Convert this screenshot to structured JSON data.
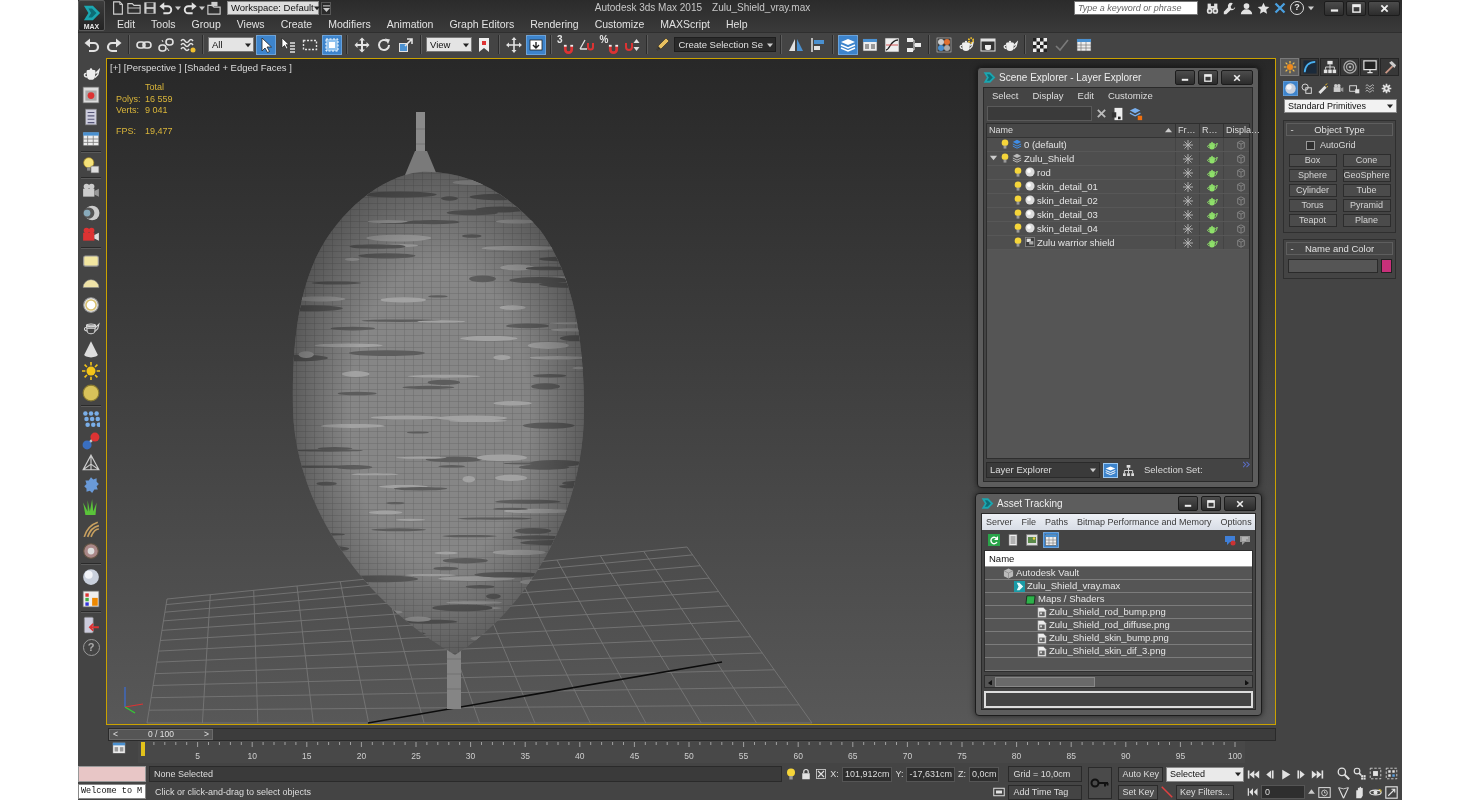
{
  "title_bar": {
    "logo": "MAX",
    "workspace": "Workspace: Default",
    "title": "Autodesk 3ds Max 2015",
    "file": "Zulu_Shield_vray.max",
    "search": {
      "placeholder": "Type a keyword or phrase"
    },
    "help": "?"
  },
  "menu": [
    "Edit",
    "Tools",
    "Group",
    "Views",
    "Create",
    "Modifiers",
    "Animation",
    "Graph Editors",
    "Rendering",
    "Customize",
    "MAXScript",
    "Help"
  ],
  "main_toolbar": [
    {
      "kind": "tool",
      "active": false
    },
    {
      "kind": "tool",
      "active": false
    },
    {
      "kind": "tool",
      "active": false
    },
    {
      "kind": "tool",
      "active": false
    },
    {
      "kind": "tool",
      "active": false
    },
    {
      "kind": "dropdown",
      "value": "All"
    },
    {
      "kind": "tool",
      "active": true
    },
    {
      "kind": "tool",
      "active": false
    },
    {
      "kind": "tool",
      "active": false
    },
    {
      "kind": "tool",
      "active": true
    },
    {
      "kind": "tool",
      "active": false
    },
    {
      "kind": "tool",
      "active": false
    },
    {
      "kind": "tool",
      "active": false
    },
    {
      "kind": "dropdown",
      "value": "View"
    },
    {
      "kind": "tool",
      "active": false
    },
    {
      "kind": "tool",
      "active": false
    },
    {
      "kind": "tool",
      "active": true
    },
    {
      "kind": "snap",
      "label": "3",
      "active": false
    },
    {
      "kind": "tool",
      "active": false
    },
    {
      "kind": "snap",
      "label": "%",
      "active": false
    },
    {
      "kind": "tool",
      "active": false
    },
    {
      "kind": "tool",
      "active": false
    },
    {
      "kind": "combo",
      "value": "Create Selection Se"
    },
    {
      "kind": "tool",
      "active": false
    },
    {
      "kind": "tool",
      "active": false
    },
    {
      "kind": "tool",
      "active": true
    },
    {
      "kind": "tool",
      "active": false
    },
    {
      "kind": "tool",
      "active": false
    },
    {
      "kind": "tool",
      "active": false
    },
    {
      "kind": "tool",
      "active": false
    },
    {
      "kind": "tool",
      "active": false
    },
    {
      "kind": "tool",
      "active": false
    },
    {
      "kind": "tool",
      "active": false
    },
    {
      "kind": "tool",
      "active": false
    },
    {
      "kind": "tool",
      "active": false
    },
    {
      "kind": "tool",
      "active": false
    }
  ],
  "left_toolbar": {
    "help": "?"
  },
  "viewport": {
    "labels": [
      "[+]",
      "[Perspective ]",
      "[Shaded + Edged Faces ]"
    ],
    "stats_heading": "Total",
    "counts": [
      {
        "label": "Polys:",
        "value": "16 559"
      },
      {
        "label": "Verts:",
        "value": "9 041"
      }
    ],
    "performance": [
      {
        "label": "FPS:",
        "value": "19,477"
      }
    ]
  },
  "scene_explorer": {
    "title": "Scene Explorer - Layer Explorer",
    "menu": [
      "Select",
      "Display",
      "Edit",
      "Customize"
    ],
    "columns": [
      "Name",
      "Fr…",
      "R…",
      "Displa…"
    ],
    "tree": [
      {
        "kind": "layer",
        "name": "0 (default)",
        "current": true,
        "visible": true,
        "frozen": false,
        "renderable": true
      },
      {
        "kind": "layer",
        "name": "Zulu_Shield",
        "current": false,
        "expanded": true,
        "visible": true,
        "frozen": false,
        "renderable": true,
        "children": [
          {
            "kind": "object",
            "name": "rod",
            "visible": true,
            "frozen": false,
            "renderable": true
          },
          {
            "kind": "object",
            "name": "skin_detail_01",
            "visible": true,
            "frozen": false,
            "renderable": true
          },
          {
            "kind": "object",
            "name": "skin_detail_02",
            "visible": true,
            "frozen": false,
            "renderable": true
          },
          {
            "kind": "object",
            "name": "skin_detail_03",
            "visible": true,
            "frozen": false,
            "renderable": true
          },
          {
            "kind": "object",
            "name": "skin_detail_04",
            "visible": true,
            "frozen": false,
            "renderable": true
          },
          {
            "kind": "group",
            "name": "Zulu warrior shield",
            "visible": true,
            "frozen": false,
            "renderable": true
          }
        ]
      }
    ],
    "explorer": "Layer Explorer",
    "modes": [
      {
        "selected": true
      },
      {
        "selected": false
      }
    ],
    "selection_set": "Selection Set:"
  },
  "asset_tracking": {
    "title": "Asset Tracking",
    "menu": [
      "Server",
      "File",
      "Paths",
      "Bitmap Performance and Memory",
      "Options"
    ],
    "views": [
      {
        "selected": false
      },
      {
        "selected": false
      },
      {
        "selected": false
      },
      {
        "selected": true
      }
    ],
    "columns": [
      "Name"
    ],
    "tree": [
      {
        "kind": "provider",
        "name": "Autodesk Vault",
        "children": [
          {
            "kind": "scene",
            "name": "Zulu_Shield_vray.max",
            "children": [
              {
                "kind": "folder",
                "name": "Maps / Shaders",
                "children": [
                  {
                    "kind": "bitmap",
                    "name": "Zulu_Shield_rod_bump.png"
                  },
                  {
                    "kind": "bitmap",
                    "name": "Zulu_Shield_rod_diffuse.png"
                  },
                  {
                    "kind": "bitmap",
                    "name": "Zulu_Shield_skin_bump.png"
                  },
                  {
                    "kind": "bitmap",
                    "name": "Zulu_Shield_skin_dif_3.png"
                  }
                ]
              }
            ]
          }
        ]
      }
    ]
  },
  "command_panel": {
    "tabs": [
      {
        "selected": true
      },
      {
        "selected": false
      },
      {
        "selected": false
      },
      {
        "selected": false
      },
      {
        "selected": false
      },
      {
        "selected": false
      }
    ],
    "categories": [
      {
        "selected": true
      },
      {
        "selected": false
      },
      {
        "selected": false
      },
      {
        "selected": false
      },
      {
        "selected": false
      },
      {
        "selected": false
      },
      {
        "selected": false
      }
    ],
    "object_class": "Standard Primitives",
    "rollouts": [
      {
        "kind": "object_type",
        "toggle": "-",
        "title": "Object Type",
        "autogrid": {
          "label": "AutoGrid",
          "checked": false
        },
        "buttons": [
          "Box",
          "Cone",
          "Sphere",
          "GeoSphere",
          "Cylinder",
          "Tube",
          "Torus",
          "Pyramid",
          "Teapot",
          "Plane"
        ]
      },
      {
        "kind": "name_and_color",
        "toggle": "-",
        "title": "Name and Color",
        "color": "#c8307a"
      }
    ]
  },
  "time_slider": {
    "prev": "<",
    "position": "0 / 100",
    "next": ">",
    "level": 0
  },
  "track_bar": {
    "labels": [
      "5",
      "10",
      "15",
      "20",
      "25",
      "30",
      "35",
      "40",
      "45",
      "50",
      "55",
      "60",
      "65",
      "70",
      "75",
      "80",
      "85",
      "90",
      "95",
      "100"
    ]
  },
  "status_bar": {
    "listener_output": "Welcome to M",
    "selection": "None Selected",
    "prompt": "Click or click-and-drag to select objects",
    "coordinates": [
      {
        "axis": "X:",
        "value": "101,912cm"
      },
      {
        "axis": "Y:",
        "value": "-17,631cm"
      },
      {
        "axis": "Z:",
        "value": "0,0cm"
      }
    ],
    "grid": "Grid = 10,0cm",
    "time_tag": "Add Time Tag",
    "auto_key": "Auto Key",
    "key_mode": "Selected",
    "set_key": "Set Key",
    "key_filters": "Key Filters...",
    "frame": "0"
  }
}
